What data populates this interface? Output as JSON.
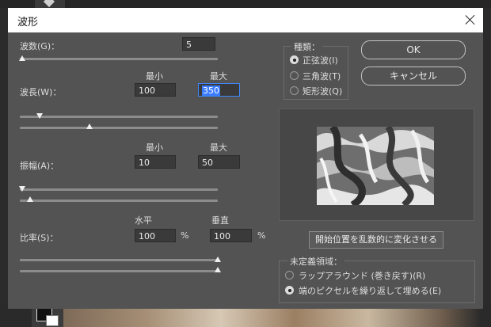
{
  "dialog": {
    "title": "波形"
  },
  "generators": {
    "label": "波数(G)：",
    "value": "5",
    "slider_fraction": 0.01
  },
  "wavelength": {
    "label": "波長(W)：",
    "min_header": "最小",
    "max_header": "最大",
    "min_value": "100",
    "max_value": "350",
    "min_slider_fraction": 0.1,
    "max_slider_fraction": 0.35
  },
  "amplitude": {
    "label": "振幅(A)：",
    "min_header": "最小",
    "max_header": "最大",
    "min_value": "10",
    "max_value": "50",
    "min_slider_fraction": 0.01,
    "max_slider_fraction": 0.05
  },
  "scale": {
    "label": "比率(S)：",
    "horizontal_header": "水平",
    "vertical_header": "垂直",
    "horizontal_value": "100",
    "vertical_value": "100",
    "unit": "%",
    "horizontal_slider_fraction": 1.0,
    "vertical_slider_fraction": 1.0
  },
  "type_group": {
    "title": "種類：",
    "options": [
      {
        "label": "正弦波(I)",
        "selected": true
      },
      {
        "label": "三角波(T)",
        "selected": false
      },
      {
        "label": "矩形波(Q)",
        "selected": false
      }
    ]
  },
  "buttons": {
    "ok": "OK",
    "cancel": "キャンセル",
    "randomize": "開始位置を乱数的に変化させる"
  },
  "undefined_areas": {
    "title": "未定義領域：",
    "options": [
      {
        "label": "ラップアラウンド (巻き戻す)(R)",
        "selected": false
      },
      {
        "label": "端のピクセルを繰り返して埋める(E)",
        "selected": true
      }
    ]
  },
  "colors": {
    "dialog_bg": "#535353",
    "titlebar_bg": "#ffffff",
    "input_bg": "#3a3a3a",
    "selection_blue": "#3b7cff"
  }
}
